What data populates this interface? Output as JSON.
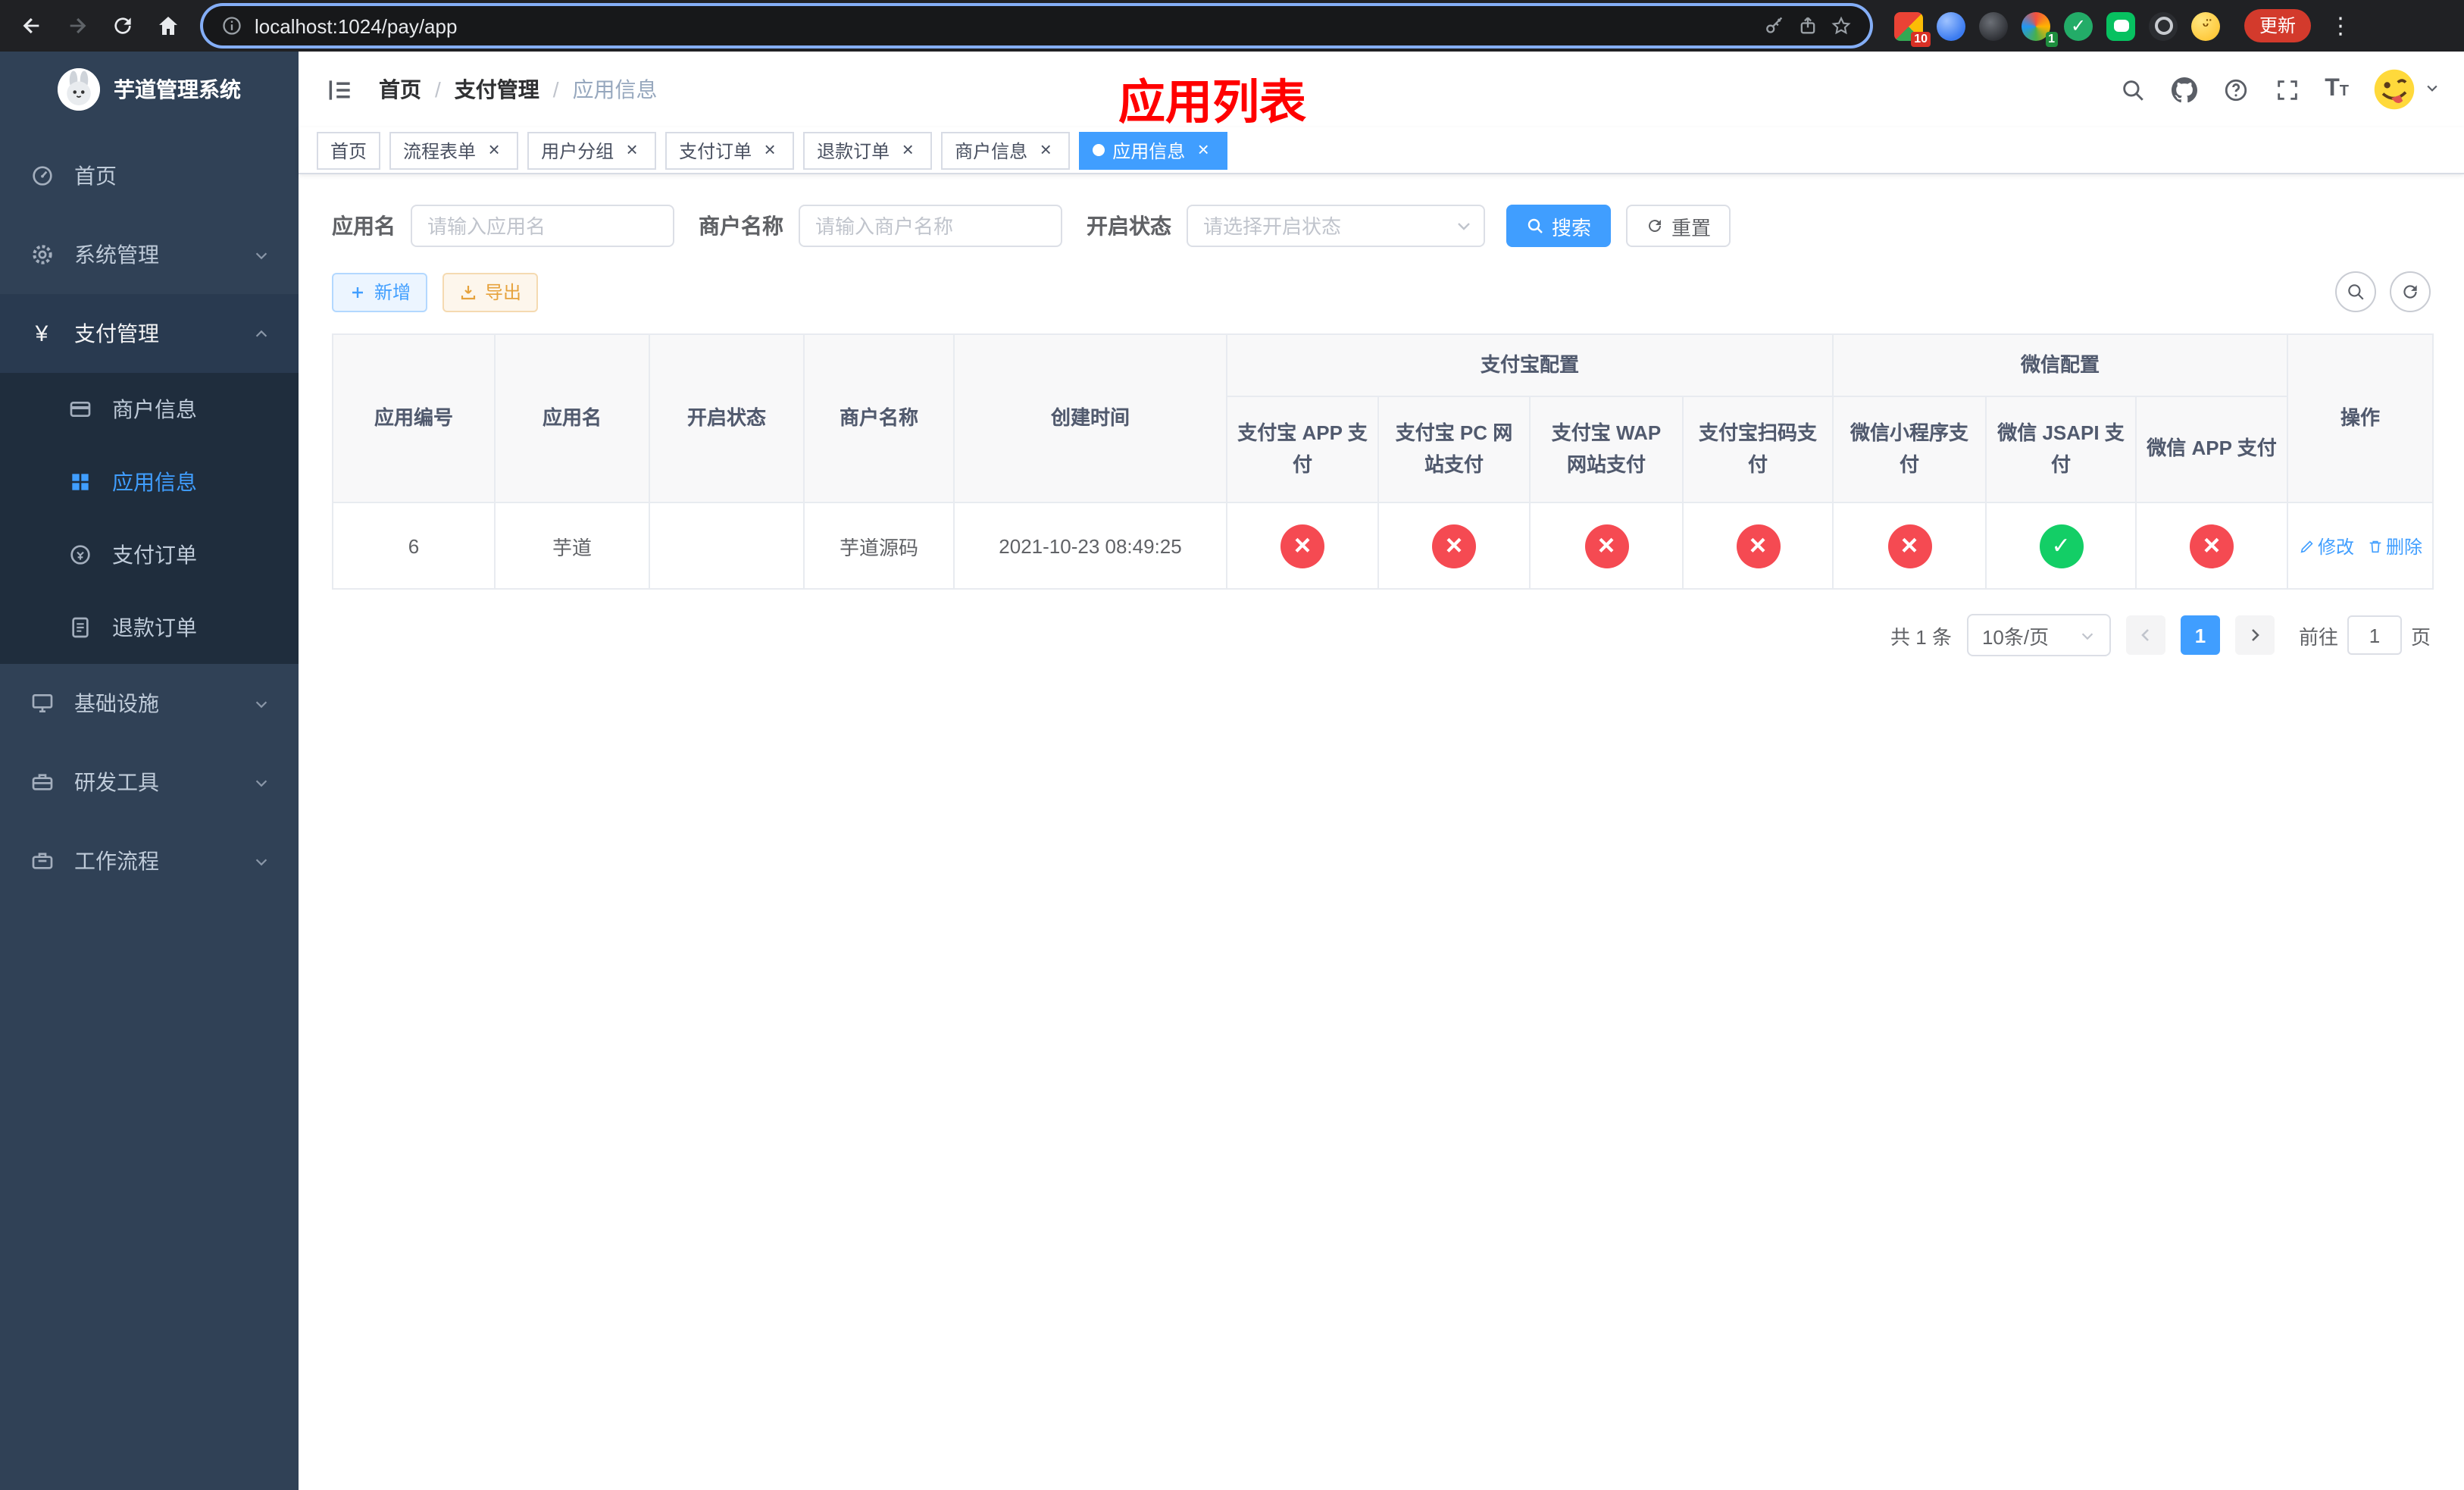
{
  "colors": {
    "accent": "#409eff",
    "success": "#13ce66",
    "danger": "#f54a52",
    "warning": "#e6a23c",
    "annotation": "#ff0000",
    "sidebar_bg": "#304156",
    "submenu_bg": "#1f2d3d"
  },
  "browser": {
    "url": "localhost:1024/pay/app",
    "update_label": "更新",
    "badges": {
      "ext1": "10",
      "ext4": "1"
    }
  },
  "sidebar": {
    "title": "芋道管理系统",
    "items": [
      {
        "label": "首页"
      },
      {
        "label": "系统管理"
      },
      {
        "label": "支付管理"
      },
      {
        "label": "商户信息"
      },
      {
        "label": "应用信息"
      },
      {
        "label": "支付订单"
      },
      {
        "label": "退款订单"
      },
      {
        "label": "基础设施"
      },
      {
        "label": "研发工具"
      },
      {
        "label": "工作流程"
      }
    ]
  },
  "header": {
    "breadcrumb": [
      "首页",
      "支付管理",
      "应用信息"
    ],
    "annotation": "应用列表"
  },
  "tabs": [
    {
      "label": "首页",
      "closable": false,
      "active": false
    },
    {
      "label": "流程表单",
      "closable": true,
      "active": false
    },
    {
      "label": "用户分组",
      "closable": true,
      "active": false
    },
    {
      "label": "支付订单",
      "closable": true,
      "active": false
    },
    {
      "label": "退款订单",
      "closable": true,
      "active": false
    },
    {
      "label": "商户信息",
      "closable": true,
      "active": false
    },
    {
      "label": "应用信息",
      "closable": true,
      "active": true
    }
  ],
  "filters": {
    "app_name_label": "应用名",
    "app_name_placeholder": "请输入应用名",
    "merchant_name_label": "商户名称",
    "merchant_name_placeholder": "请输入商户名称",
    "status_label": "开启状态",
    "status_placeholder": "请选择开启状态",
    "search_label": "搜索",
    "reset_label": "重置"
  },
  "toolbar": {
    "add_label": "新增",
    "export_label": "导出"
  },
  "table": {
    "headers": {
      "app_id": "应用编号",
      "app_name": "应用名",
      "status": "开启状态",
      "merchant_name": "商户名称",
      "create_time": "创建时间",
      "alipay_group": "支付宝配置",
      "wechat_group": "微信配置",
      "alipay_app": "支付宝 APP 支付",
      "alipay_pc": "支付宝 PC 网站支付",
      "alipay_wap": "支付宝 WAP 网站支付",
      "alipay_qr": "支付宝扫码支付",
      "wx_lite": "微信小程序支付",
      "wx_jsapi": "微信 JSAPI 支付",
      "wx_app": "微信 APP 支付",
      "actions": "操作"
    },
    "row": {
      "app_id": "6",
      "app_name": "芋道",
      "enabled": true,
      "merchant_name": "芋道源码",
      "create_time": "2021-10-23 08:49:25",
      "statuses": [
        false,
        false,
        false,
        false,
        false,
        true,
        false
      ],
      "edit_label": "修改",
      "delete_label": "删除"
    }
  },
  "pagination": {
    "total_label": "共 1 条",
    "page_size": "10条/页",
    "current_page": "1",
    "goto_label": "前往",
    "goto_value": "1",
    "page_label": "页"
  }
}
